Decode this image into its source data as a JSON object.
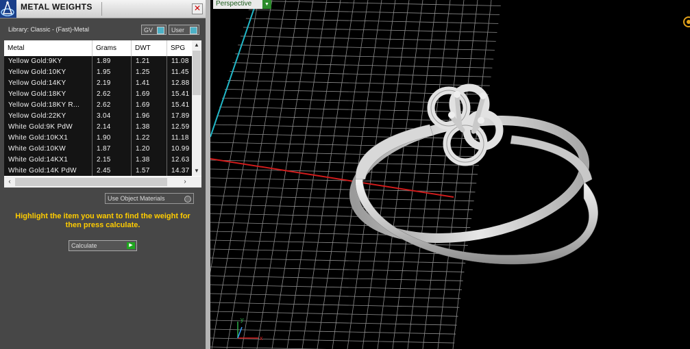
{
  "panel": {
    "title": "METAL WEIGHTS",
    "close_glyph": "✕",
    "library_label": "Library: Classic - (Fast)-Metal",
    "toggles": [
      {
        "label": "GV"
      },
      {
        "label": "User"
      }
    ],
    "columns": [
      "Metal",
      "Grams",
      "DWT",
      "SPG"
    ],
    "rows": [
      [
        "Yellow Gold:9KY",
        "1.89",
        "1.21",
        "11.08"
      ],
      [
        "Yellow Gold:10KY",
        "1.95",
        "1.25",
        "11.45"
      ],
      [
        "Yellow Gold:14KY",
        "2.19",
        "1.41",
        "12.88"
      ],
      [
        "Yellow Gold:18KY",
        "2.62",
        "1.69",
        "15.41"
      ],
      [
        "Yellow Gold:18KY R...",
        "2.62",
        "1.69",
        "15.41"
      ],
      [
        "Yellow Gold:22KY",
        "3.04",
        "1.96",
        "17.89"
      ],
      [
        "White Gold:9K PdW",
        "2.14",
        "1.38",
        "12.59"
      ],
      [
        "White Gold:10KX1",
        "1.90",
        "1.22",
        "11.18"
      ],
      [
        "White Gold:10KW",
        "1.87",
        "1.20",
        "10.99"
      ],
      [
        "White Gold:14KX1",
        "2.15",
        "1.38",
        "12.63"
      ],
      [
        "White Gold:14K PdW",
        "2.45",
        "1.57",
        "14.37"
      ]
    ],
    "use_object_materials": "Use Object Materials",
    "instructions": "Highlight the item you want to find the weight for then press calculate.",
    "calculate_label": "Calculate"
  },
  "viewport": {
    "label": "Perspective",
    "axis_x": "x",
    "axis_y": "y",
    "grid_color": "#9a9a9a",
    "x_axis_color": "#cc1a1a",
    "y_axis_color": "#22b8c8",
    "ring_color": "#d6d6d6"
  },
  "icons": [
    "app-logo-icon",
    "close-icon",
    "checkbox-icon",
    "scroll-up-icon",
    "scroll-down-icon",
    "scroll-left-icon",
    "scroll-right-icon",
    "play-arrow-icon",
    "dropdown-arrow-icon",
    "orbit-icon"
  ]
}
